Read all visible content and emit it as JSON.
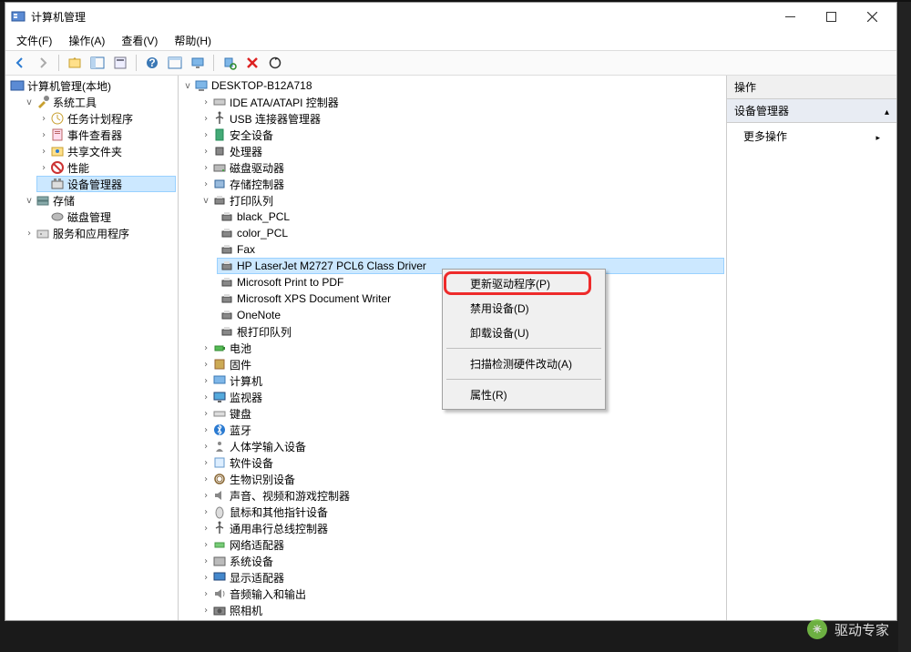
{
  "window": {
    "title": "计算机管理",
    "menus": [
      "文件(F)",
      "操作(A)",
      "查看(V)",
      "帮助(H)"
    ]
  },
  "leftTree": {
    "root": "计算机管理(本地)",
    "sys": "系统工具",
    "sysChildren": [
      "任务计划程序",
      "事件查看器",
      "共享文件夹",
      "性能",
      "设备管理器"
    ],
    "selectedIndex": 4,
    "storage": "存储",
    "storageChildren": [
      "磁盘管理"
    ],
    "services": "服务和应用程序"
  },
  "midTree": {
    "root": "DESKTOP-B12A718",
    "cats": [
      {
        "label": "IDE ATA/ATAPI 控制器",
        "icon": "ide"
      },
      {
        "label": "USB 连接器管理器",
        "icon": "usb"
      },
      {
        "label": "安全设备",
        "icon": "security"
      },
      {
        "label": "处理器",
        "icon": "cpu"
      },
      {
        "label": "磁盘驱动器",
        "icon": "disk"
      },
      {
        "label": "存储控制器",
        "icon": "storage"
      },
      {
        "label": "打印队列",
        "icon": "printer",
        "expanded": true,
        "children": [
          "black_PCL",
          "color_PCL",
          "Fax",
          "HP LaserJet M2727 PCL6 Class Driver",
          "Microsoft Print to PDF",
          "Microsoft XPS Document Writer",
          "OneNote",
          "根打印队列"
        ],
        "selectedChild": 3
      },
      {
        "label": "电池",
        "icon": "battery"
      },
      {
        "label": "固件",
        "icon": "firmware"
      },
      {
        "label": "计算机",
        "icon": "computer"
      },
      {
        "label": "监视器",
        "icon": "monitor"
      },
      {
        "label": "键盘",
        "icon": "keyboard"
      },
      {
        "label": "蓝牙",
        "icon": "bluetooth"
      },
      {
        "label": "人体学输入设备",
        "icon": "hid"
      },
      {
        "label": "软件设备",
        "icon": "software"
      },
      {
        "label": "生物识别设备",
        "icon": "biometric"
      },
      {
        "label": "声音、视频和游戏控制器",
        "icon": "audio"
      },
      {
        "label": "鼠标和其他指针设备",
        "icon": "mouse"
      },
      {
        "label": "通用串行总线控制器",
        "icon": "usb"
      },
      {
        "label": "网络适配器",
        "icon": "network"
      },
      {
        "label": "系统设备",
        "icon": "system"
      },
      {
        "label": "显示适配器",
        "icon": "display"
      },
      {
        "label": "音频输入和输出",
        "icon": "audioin"
      },
      {
        "label": "照相机",
        "icon": "camera"
      }
    ]
  },
  "rightPane": {
    "header": "操作",
    "section": "设备管理器",
    "more": "更多操作"
  },
  "contextMenu": {
    "items": [
      "更新驱动程序(P)",
      "禁用设备(D)",
      "卸载设备(U)",
      "—",
      "扫描检测硬件改动(A)",
      "—",
      "属性(R)"
    ]
  },
  "watermark": "驱动专家"
}
